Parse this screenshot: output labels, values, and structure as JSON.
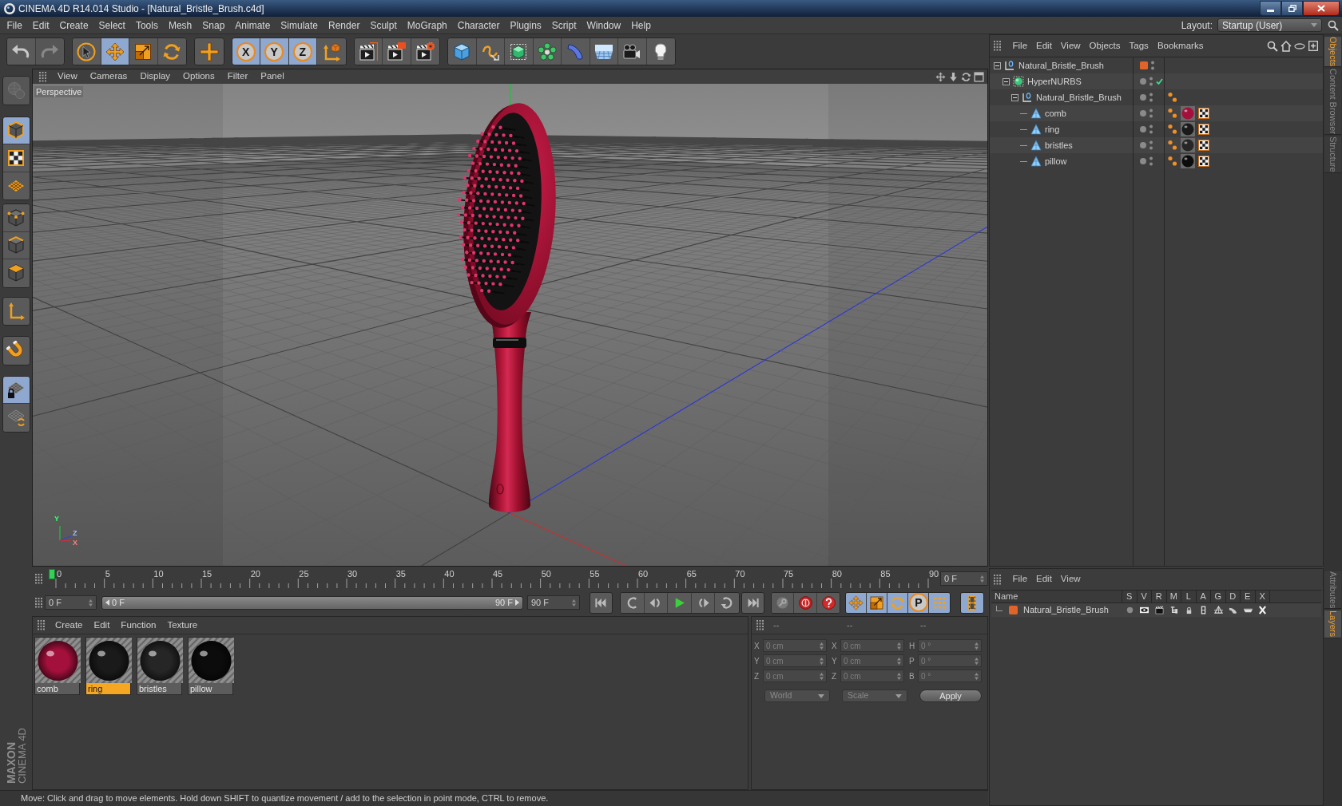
{
  "window": {
    "title": "CINEMA 4D R14.014 Studio - [Natural_Bristle_Brush.c4d]"
  },
  "menu_bar": {
    "items": [
      "File",
      "Edit",
      "Create",
      "Select",
      "Tools",
      "Mesh",
      "Snap",
      "Animate",
      "Simulate",
      "Render",
      "Sculpt",
      "MoGraph",
      "Character",
      "Plugins",
      "Script",
      "Window",
      "Help"
    ],
    "layout_label": "Layout:",
    "layout_value": "Startup (User)"
  },
  "toolbar": {
    "groups": [
      {
        "items": [
          {
            "kind": "undo",
            "active": false,
            "disabled": false
          },
          {
            "kind": "redo",
            "active": false,
            "disabled": true
          }
        ]
      },
      {
        "items": [
          {
            "kind": "select",
            "active": false,
            "disabled": false
          },
          {
            "kind": "move",
            "active": true,
            "disabled": false
          },
          {
            "kind": "scale",
            "active": false,
            "disabled": false
          },
          {
            "kind": "rotate",
            "active": false,
            "disabled": false
          }
        ]
      },
      {
        "items": [
          {
            "kind": "add",
            "active": false,
            "disabled": false
          }
        ]
      },
      {
        "items": [
          {
            "kind": "axis",
            "label": "X",
            "active": true,
            "disabled": false
          },
          {
            "kind": "axis",
            "label": "Y",
            "active": true,
            "disabled": false
          },
          {
            "kind": "axis",
            "label": "Z",
            "active": true,
            "disabled": false
          },
          {
            "kind": "coord_system",
            "active": false,
            "disabled": false
          }
        ]
      },
      {
        "items": [
          {
            "kind": "render_view",
            "active": false,
            "disabled": false
          },
          {
            "kind": "render_picture",
            "active": false,
            "disabled": false
          },
          {
            "kind": "render_settings",
            "active": false,
            "disabled": false
          }
        ]
      },
      {
        "items": [
          {
            "kind": "cube",
            "active": false,
            "disabled": false
          },
          {
            "kind": "spline",
            "active": false,
            "disabled": false
          },
          {
            "kind": "subdivision",
            "active": false,
            "disabled": false
          },
          {
            "kind": "cloner",
            "active": false,
            "disabled": false
          },
          {
            "kind": "deformer",
            "active": false,
            "disabled": false
          },
          {
            "kind": "floor",
            "active": false,
            "disabled": false
          },
          {
            "kind": "camera",
            "active": false,
            "disabled": false
          },
          {
            "kind": "light",
            "active": false,
            "disabled": false
          }
        ]
      }
    ]
  },
  "left_toolbar": {
    "groups": [
      {
        "items": [
          {
            "kind": "make_editable",
            "active": false,
            "disabled": true
          }
        ]
      },
      {
        "items": [
          {
            "kind": "model",
            "active": true,
            "disabled": false
          },
          {
            "kind": "texture",
            "active": false,
            "disabled": false
          },
          {
            "kind": "workplane",
            "active": false,
            "disabled": false
          }
        ]
      },
      {
        "items": [
          {
            "kind": "points",
            "active": false,
            "disabled": false
          },
          {
            "kind": "edges",
            "active": false,
            "disabled": false
          },
          {
            "kind": "polygons",
            "active": false,
            "disabled": false
          }
        ]
      },
      {
        "items": [
          {
            "kind": "axis_mode",
            "active": false,
            "disabled": false
          }
        ]
      },
      {
        "items": [
          {
            "kind": "magnet",
            "active": false,
            "disabled": false
          }
        ]
      },
      {
        "items": [
          {
            "kind": "workplane_lock",
            "active": true,
            "disabled": false
          },
          {
            "kind": "planar_workplane",
            "active": false,
            "disabled": false
          }
        ]
      }
    ]
  },
  "viewport": {
    "menu": [
      "View",
      "Cameras",
      "Display",
      "Options",
      "Filter",
      "Panel"
    ],
    "camera": "Perspective",
    "gizmo_labels": [
      "Y",
      "Z",
      "X"
    ]
  },
  "timeline": {
    "ticks": [
      "0",
      "5",
      "10",
      "15",
      "20",
      "25",
      "30",
      "35",
      "40",
      "45",
      "50",
      "55",
      "60",
      "65",
      "70",
      "75",
      "80",
      "85",
      "90"
    ],
    "level": 0,
    "current_frame": "0 F"
  },
  "transport": {
    "start_field": "0 F",
    "range": {
      "start": "0 F",
      "end": "90 F",
      "level": 1
    },
    "end_field": "90 F",
    "groups": [
      {
        "items": [
          {
            "kind": "go_start",
            "active": false
          }
        ]
      },
      {
        "items": [
          {
            "kind": "prev_key",
            "active": false
          },
          {
            "kind": "prev_frame",
            "active": false
          },
          {
            "kind": "play",
            "active": false
          },
          {
            "kind": "next_frame",
            "active": false
          },
          {
            "kind": "next_key",
            "active": false
          }
        ]
      },
      {
        "items": [
          {
            "kind": "go_end",
            "active": false
          }
        ]
      },
      {
        "items": [
          {
            "kind": "key_record",
            "active": false
          },
          {
            "kind": "autokey",
            "active": false
          },
          {
            "kind": "key_selection",
            "active": false
          }
        ]
      },
      {
        "items": [
          {
            "kind": "track_move",
            "active": true
          },
          {
            "kind": "track_scale",
            "active": true
          },
          {
            "kind": "track_rotate",
            "active": true
          },
          {
            "kind": "track_param",
            "label": "P",
            "active": true
          },
          {
            "kind": "track_points",
            "active": true
          }
        ]
      },
      {
        "items": [
          {
            "kind": "timeline_window",
            "active": true
          }
        ]
      }
    ]
  },
  "materials": {
    "menu": [
      "Create",
      "Edit",
      "Function",
      "Texture"
    ],
    "items": [
      {
        "name": "comb",
        "color": "#a3103c",
        "selected": false
      },
      {
        "name": "ring",
        "color": "#1a1a1a",
        "selected": true
      },
      {
        "name": "bristles",
        "color": "#262626",
        "selected": false
      },
      {
        "name": "pillow",
        "color": "#0c0c0c",
        "selected": false
      }
    ]
  },
  "coordinates": {
    "headers": [
      "--",
      "--",
      "--"
    ],
    "rows": [
      [
        {
          "axis": "X",
          "value": "0 cm"
        },
        {
          "axis": "X",
          "value": "0 cm"
        },
        {
          "axis": "H",
          "value": "0 °"
        }
      ],
      [
        {
          "axis": "Y",
          "value": "0 cm"
        },
        {
          "axis": "Y",
          "value": "0 cm"
        },
        {
          "axis": "P",
          "value": "0 °"
        }
      ],
      [
        {
          "axis": "Z",
          "value": "0 cm"
        },
        {
          "axis": "Z",
          "value": "0 cm"
        },
        {
          "axis": "B",
          "value": "0 °"
        }
      ]
    ],
    "dropdowns": [
      "World",
      "Scale"
    ],
    "apply": "Apply"
  },
  "status_bar": {
    "text": "Move: Click and drag to move elements. Hold down SHIFT to quantize movement / add to the selection in point mode, CTRL to remove."
  },
  "objects": {
    "menu": [
      "File",
      "Edit",
      "View",
      "Objects",
      "Tags",
      "Bookmarks"
    ],
    "tree": [
      {
        "name": "Natural_Bristle_Brush",
        "kind": "null",
        "expanded": true,
        "layer": true,
        "enabled": false,
        "children": [
          {
            "name": "HyperNURBS",
            "kind": "hypernurbs",
            "expanded": true,
            "layer": false,
            "enabled": true,
            "children": [
              {
                "name": "Natural_Bristle_Brush",
                "kind": "null",
                "expanded": true,
                "layer": false,
                "enabled": false,
                "tags": [
                  {
                    "kind": "phong"
                  }
                ],
                "children": [
                  {
                    "name": "comb",
                    "kind": "polygon",
                    "layer": false,
                    "enabled": false,
                    "tags": [
                      {
                        "kind": "phong"
                      },
                      {
                        "kind": "material",
                        "color": "#a3103c"
                      },
                      {
                        "kind": "uvw"
                      }
                    ]
                  },
                  {
                    "name": "ring",
                    "kind": "polygon",
                    "layer": false,
                    "enabled": false,
                    "tags": [
                      {
                        "kind": "phong"
                      },
                      {
                        "kind": "material",
                        "color": "#1a1a1a"
                      },
                      {
                        "kind": "uvw"
                      }
                    ]
                  },
                  {
                    "name": "bristles",
                    "kind": "polygon",
                    "layer": false,
                    "enabled": false,
                    "tags": [
                      {
                        "kind": "phong"
                      },
                      {
                        "kind": "material",
                        "color": "#262626"
                      },
                      {
                        "kind": "uvw"
                      }
                    ]
                  },
                  {
                    "name": "pillow",
                    "kind": "polygon",
                    "layer": false,
                    "enabled": false,
                    "tags": [
                      {
                        "kind": "phong"
                      },
                      {
                        "kind": "material",
                        "color": "#0c0c0c"
                      },
                      {
                        "kind": "uvw"
                      }
                    ]
                  }
                ]
              }
            ]
          }
        ]
      }
    ]
  },
  "layers": {
    "menu": [
      "File",
      "Edit",
      "View"
    ],
    "columns": [
      "Name",
      "S",
      "V",
      "R",
      "M",
      "L",
      "A",
      "G",
      "D",
      "E",
      "X"
    ],
    "rows": [
      {
        "name": "Natural_Bristle_Brush",
        "color": "#e0642a",
        "flags": [
          {
            "kind": "solo"
          },
          {
            "kind": "visible"
          },
          {
            "kind": "render"
          },
          {
            "kind": "manager"
          },
          {
            "kind": "locked"
          },
          {
            "kind": "animation"
          },
          {
            "kind": "generators"
          },
          {
            "kind": "deformers"
          },
          {
            "kind": "expressions"
          },
          {
            "kind": "xrefs"
          }
        ]
      }
    ]
  },
  "side_tabs": {
    "top": [
      {
        "label": "Objects",
        "selected": true
      },
      {
        "label": "Content Browser",
        "selected": false
      },
      {
        "label": "Structure",
        "selected": false
      }
    ],
    "bottom": [
      {
        "label": "Attributes",
        "selected": false
      },
      {
        "label": "Layers",
        "selected": true
      }
    ]
  },
  "logo": {
    "brand": "MAXON",
    "product": "CINEMA 4D"
  }
}
